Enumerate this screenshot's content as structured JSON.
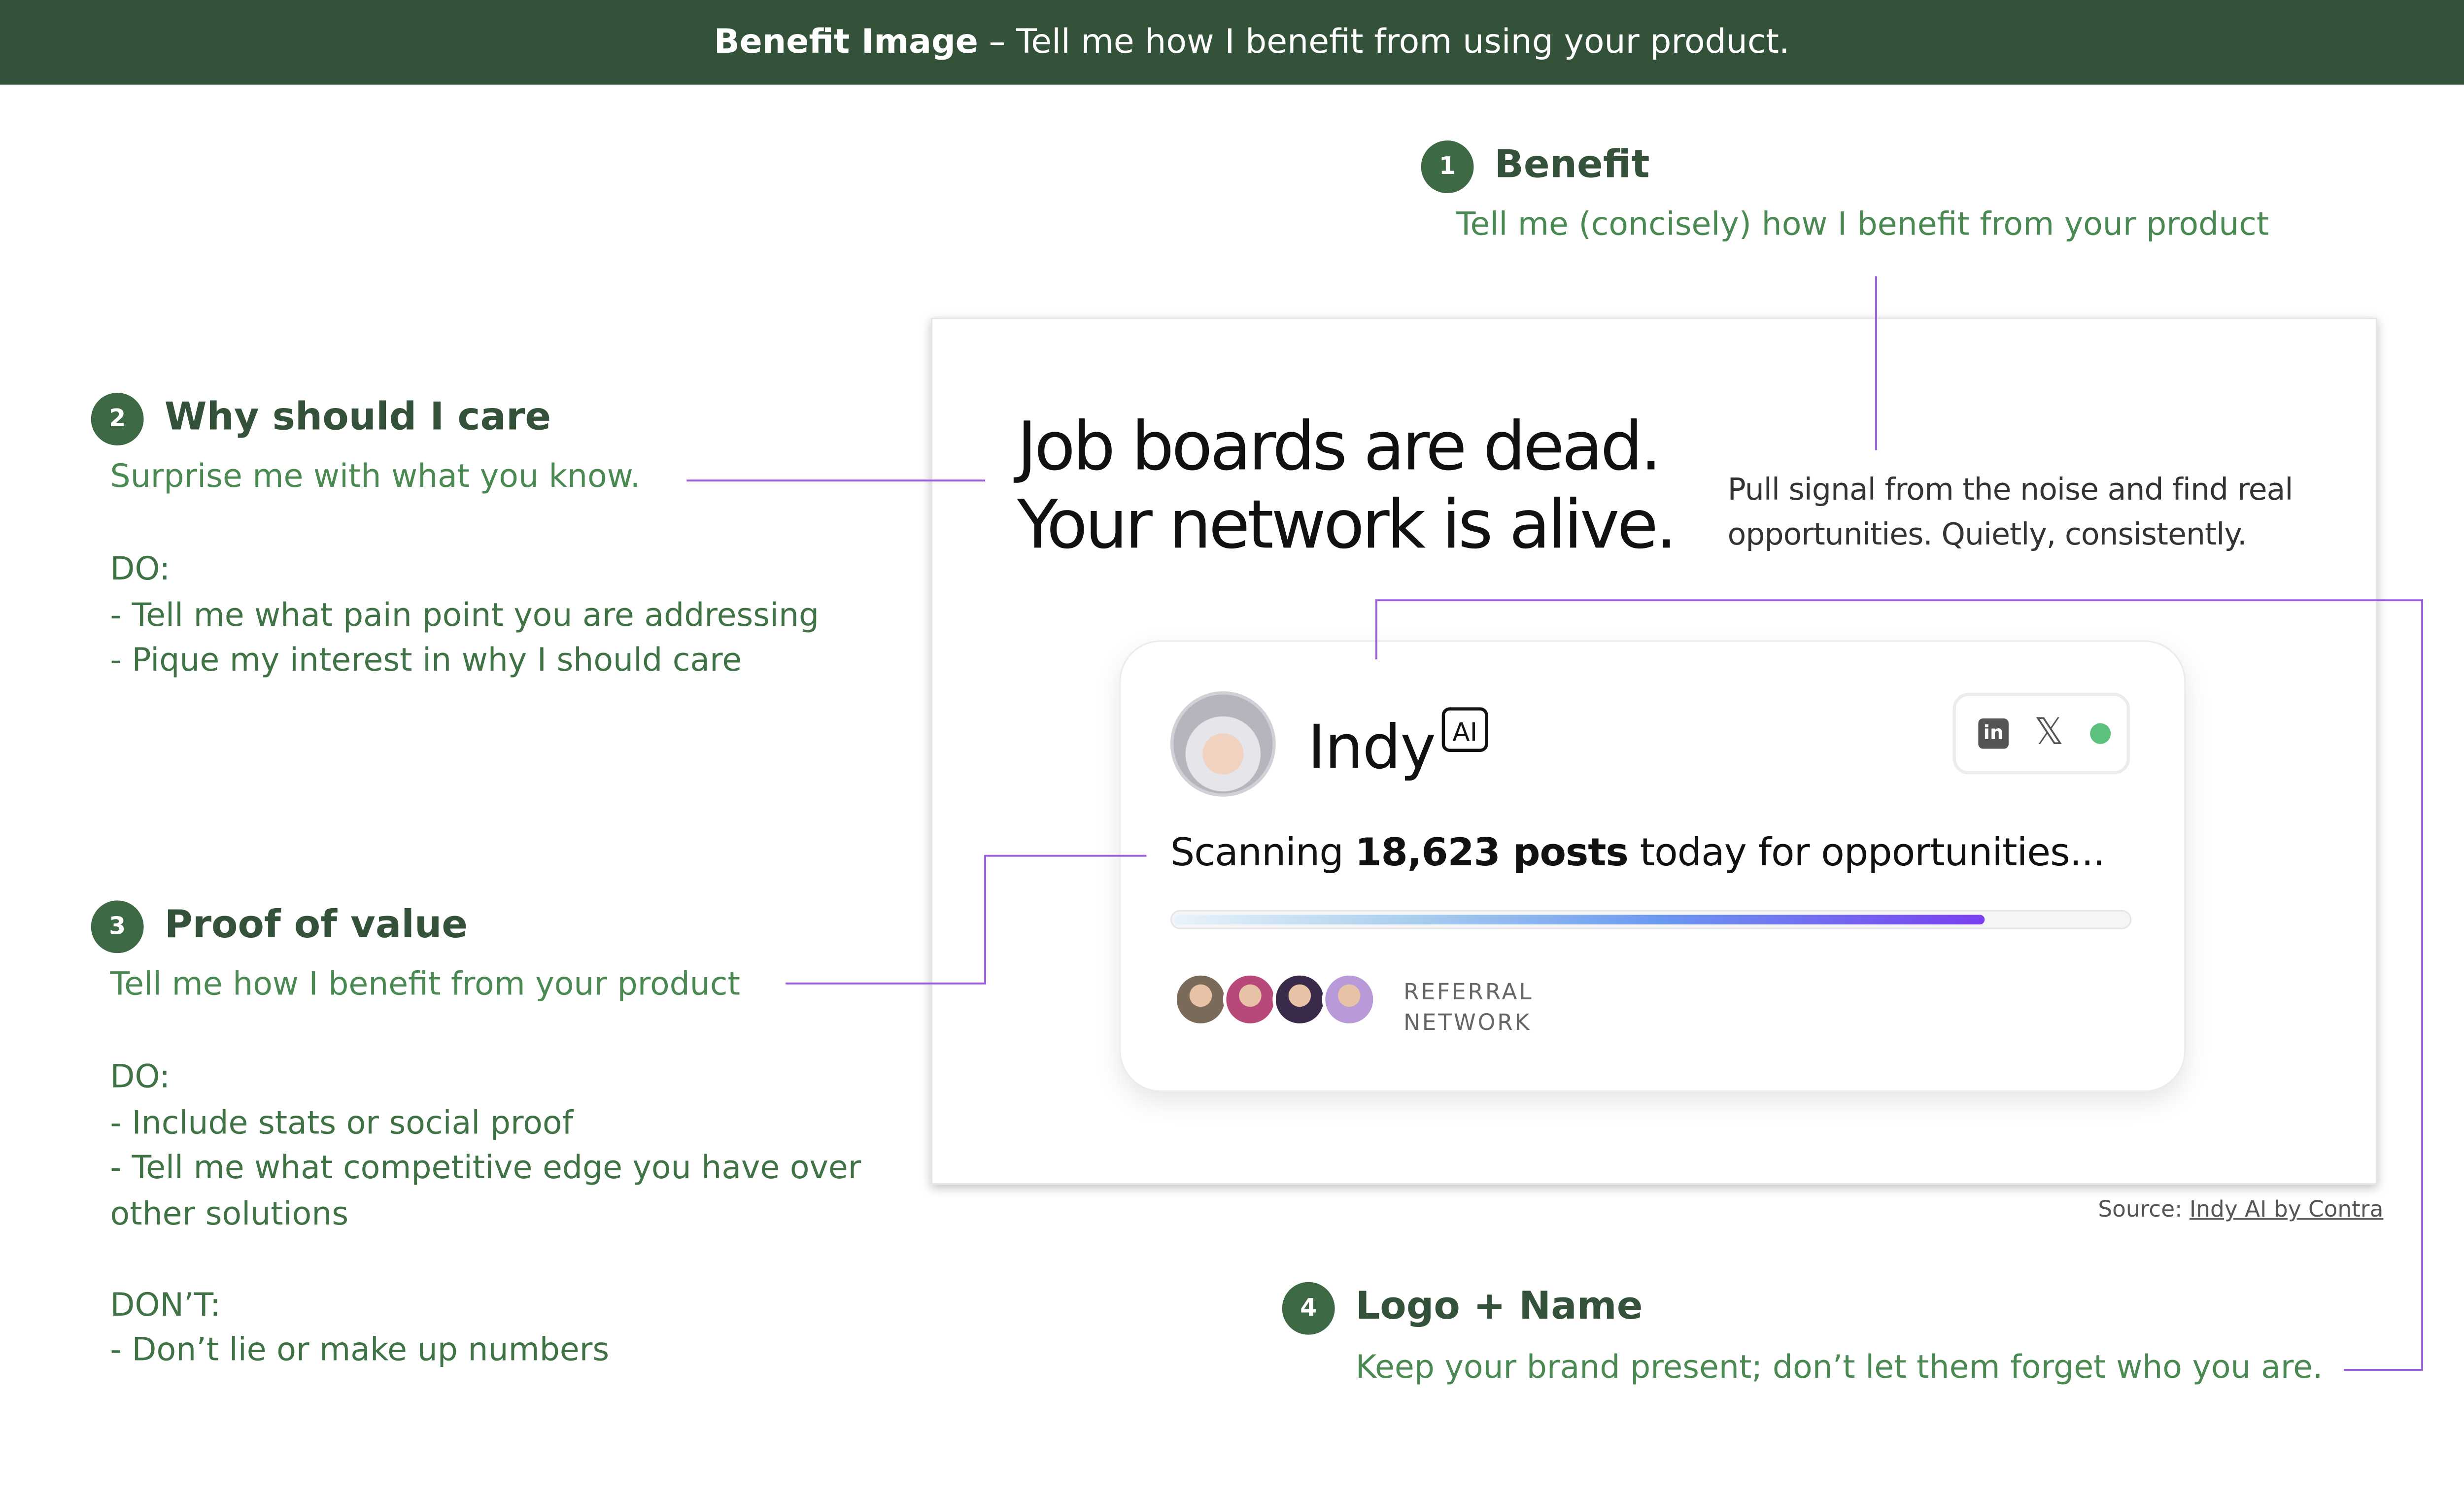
{
  "banner": {
    "title_bold": "Benefit Image",
    "title_rest": " – Tell me how I benefit from using your product."
  },
  "annotations": {
    "benefit": {
      "number": "1",
      "heading": "Benefit",
      "subtitle": "Tell me (concisely) how I benefit from your product"
    },
    "why_care": {
      "number": "2",
      "heading": "Why should I care",
      "subtitle": "Surprise me with what you know.",
      "do_label": "DO:",
      "do_items": [
        "- Tell me what pain point you are addressing",
        "- Pique my interest in why I should care"
      ]
    },
    "proof": {
      "number": "3",
      "heading": "Proof of value",
      "subtitle": "Tell me how I benefit from your product",
      "do_label": "DO:",
      "do_items": [
        "- Include stats or social proof",
        "- Tell me what competitive edge you have over",
        "other solutions"
      ],
      "dont_label": "DON’T:",
      "dont_items": [
        "- Don’t lie or make up numbers"
      ]
    },
    "logo": {
      "number": "4",
      "heading": "Logo + Name",
      "subtitle": "Keep your brand present; don’t let them forget who you are."
    }
  },
  "example": {
    "headline_line1": "Job boards are dead.",
    "headline_line2": "Your network is alive.",
    "subhead_line1": "Pull signal from the noise and find real",
    "subhead_line2": "opportunities. Quietly, consistently.",
    "card": {
      "brand_name": "Indy",
      "brand_badge": "AI",
      "social_icons": [
        "linkedin-icon",
        "x-icon",
        "status-dot"
      ],
      "scan_prefix": "Scanning ",
      "scan_count": "18,623 posts",
      "scan_suffix": " today for opportunities...",
      "progress_fraction": 0.85,
      "referral_line1": "REFERRAL",
      "referral_line2": "NETWORK",
      "avatar_colors": [
        "#7a6a5a",
        "#b9487a",
        "#3a2a4a",
        "#b89ad8"
      ]
    },
    "source_prefix": "Source: ",
    "source_link": "Indy AI by Contra"
  },
  "colors": {
    "banner_bg": "#34523a",
    "heading_green": "#34523a",
    "text_green": "#4a8a52",
    "connector_purple": "#9b5be0",
    "progress_end": "#7a3ff0",
    "status_dot": "#5cc17c"
  }
}
